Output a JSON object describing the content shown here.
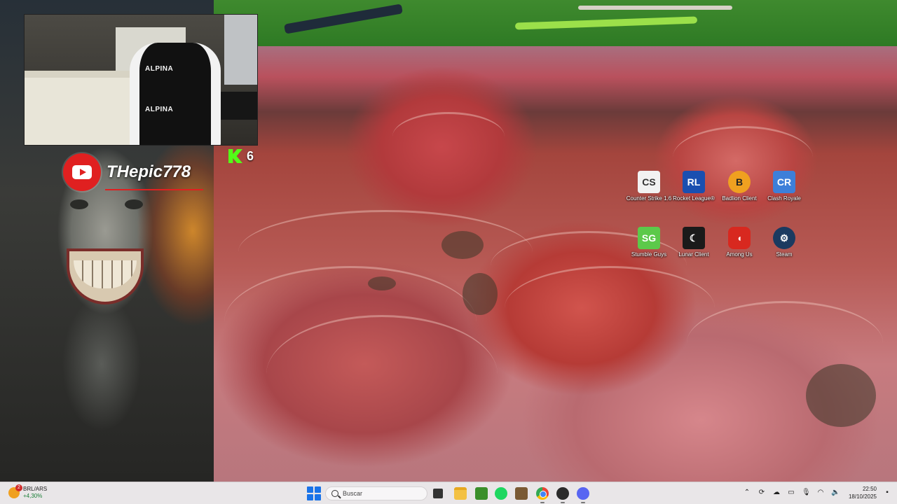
{
  "overlay": {
    "channel_name": "THepic778",
    "kick_count": "6"
  },
  "webcam": {
    "chair_brand_top": "ALPINA",
    "chair_brand_seat": "ALPINA"
  },
  "desktop_icons": [
    {
      "label": "Counter Strike 1.6",
      "icon": "counter-strike-icon"
    },
    {
      "label": "Rocket League®",
      "icon": "rocket-league-icon"
    },
    {
      "label": "Badlion Client",
      "icon": "badlion-client-icon"
    },
    {
      "label": "Clash Royale",
      "icon": "clash-royale-icon"
    },
    {
      "label": "Stumble Guys",
      "icon": "stumble-guys-icon"
    },
    {
      "label": "Lunar Client",
      "icon": "lunar-client-icon"
    },
    {
      "label": "Among Us",
      "icon": "among-us-icon"
    },
    {
      "label": "Steam",
      "icon": "steam-icon"
    }
  ],
  "taskbar": {
    "ticker": {
      "pair": "BRL/ARS",
      "change": "+4,30%",
      "badge": "2"
    },
    "search_placeholder": "Buscar",
    "apps": [
      "task-view-icon",
      "file-explorer-icon",
      "minecraft-icon",
      "spotify-icon",
      "minecraft-dirt-icon",
      "chrome-icon",
      "obs-icon",
      "discord-icon"
    ],
    "clock": {
      "time": "22:50",
      "date": "18/10/2025"
    }
  },
  "colors": {
    "youtube_red": "#e02020",
    "kick_green": "#53fc18",
    "accent_blue": "#1a73e8"
  }
}
